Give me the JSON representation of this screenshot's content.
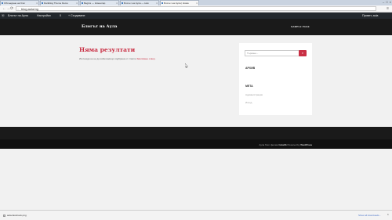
{
  "browser": {
    "tabs": [
      {
        "label": "Обсъждане на блог"
      },
      {
        "label": "Darkblog Theme Demo"
      },
      {
        "label": "Begins — Коментар"
      },
      {
        "label": "Блогът на Аула — Нов"
      },
      {
        "label": "Блогът на Аула | Няма"
      }
    ],
    "window_controls": {
      "minimize": "–",
      "maximize": "□",
      "close": "×"
    },
    "url": "blog.aula.bg",
    "back_icon": "←",
    "forward_icon": "→",
    "reload_icon": "⟳",
    "menu_icon": "≡"
  },
  "adminbar": {
    "wp_logo": "ⓦ",
    "site_name": "Блогът на Аула",
    "customize": "Настройки",
    "comments_count": "0",
    "new_item": "+ Създаване",
    "greeting": "Привет, aula"
  },
  "site": {
    "title": "Блогът на Аула",
    "nav_item": "SAMPLE PAGE"
  },
  "main": {
    "heading": "Няма резултати",
    "notice_text": "Изглежда не не да забележищо подбрана от стаята ",
    "notice_link": "Записване отвор."
  },
  "sidebar": {
    "search_placeholder": "Търсене...",
    "search_button_icon": "⌕",
    "archive_title": "АРХИВ",
    "meta_title": "МЕТА",
    "meta_links": [
      "Администрация",
      "Изход"
    ]
  },
  "footer": {
    "credit_prefix": "Аула блог филми",
    "credit_theme": "Colorlib",
    "credit_mid": " Powered by ",
    "credit_wp": "WordPress"
  },
  "downloads": {
    "item": "aula-facebook.png",
    "show_all": "Show all downloads...",
    "close": "×"
  },
  "colors": {
    "accent": "#c92f44",
    "header_bg": "#1a1a1a",
    "adminbar_bg": "#23282d"
  }
}
